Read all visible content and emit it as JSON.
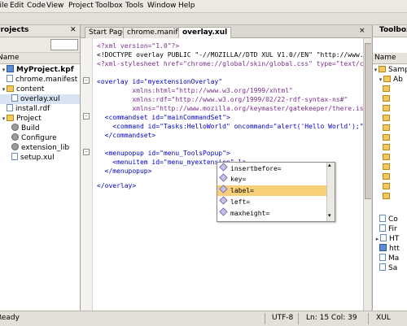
{
  "menubar": {
    "items": [
      "File",
      "Edit",
      "Code",
      "View",
      "Project",
      "Toolbox",
      "Tools",
      "Window",
      "Help"
    ]
  },
  "left_pane": {
    "title": "Projects",
    "column_header": "Name",
    "close_glyph": "✕",
    "tree": [
      {
        "label": "MyProject.kpf",
        "icon": "project-icon"
      },
      {
        "label": "chrome.manifest",
        "icon": "file-icon"
      },
      {
        "label": "content",
        "icon": "folder-icon"
      },
      {
        "label": "overlay.xul",
        "icon": "file-icon"
      },
      {
        "label": "install.rdf",
        "icon": "file-icon"
      },
      {
        "label": "Project",
        "icon": "folder-icon"
      },
      {
        "label": "Build",
        "icon": "gear-icon"
      },
      {
        "label": "Configure",
        "icon": "gear-icon"
      },
      {
        "label": "extension_lib",
        "icon": "gear-icon"
      },
      {
        "label": "setup.xul",
        "icon": "file-icon"
      }
    ]
  },
  "tabs": [
    {
      "label": "Start Page"
    },
    {
      "label": "chrome.manifest"
    },
    {
      "label": "overlay.xul"
    }
  ],
  "tab_close_glyph": "×",
  "editor": {
    "lines": [
      "<?xml version=\"1.0\"?>",
      "<!DOCTYPE overlay PUBLIC \"-//MOZILLA//DTD XUL V1.0//EN\" \"http://www.mozilla",
      "<?xml-stylesheet href=\"chrome://global/skin/global.css\" type=\"text/css\"?>",
      "",
      "<overlay id=\"myextensionOverlay\"",
      "         xmlns:html=\"http://www.w3.org/1999/xhtml\"",
      "         xmlns:rdf=\"http://www.w3.org/1999/02/22-rdf-syntax-ns#\"",
      "         xmlns=\"http://www.mozilla.org/keymaster/gatekeeper/there.is.only",
      "",
      "  <commandset id=\"mainCommandSet\">",
      "    <command id=\"Tasks:HelloWorld\" oncommand=\"alert('Hello World');\"/>",
      "  </commandset>",
      "",
      "  <menupopup id=\"menu_ToolsPopup\">",
      "    <menuitem id=\"menu_myextension\" la",
      "  </menupopup>",
      "",
      "</overlay>"
    ]
  },
  "autocomplete": {
    "items": [
      {
        "label": "insertbefore="
      },
      {
        "label": "key="
      },
      {
        "label": "label="
      },
      {
        "label": "left="
      },
      {
        "label": "maxheight="
      }
    ],
    "selected": "label="
  },
  "right_pane": {
    "title": "Toolbox",
    "column_header": "Name",
    "items": [
      "Samp",
      "Ab",
      "Co",
      "Fir",
      "HT",
      "htt",
      "Ma",
      "Sa"
    ]
  },
  "statusbar": {
    "left": "Ready",
    "encoding": "UTF-8",
    "position": "Ln: 15 Col: 39",
    "mode": "XUL"
  }
}
